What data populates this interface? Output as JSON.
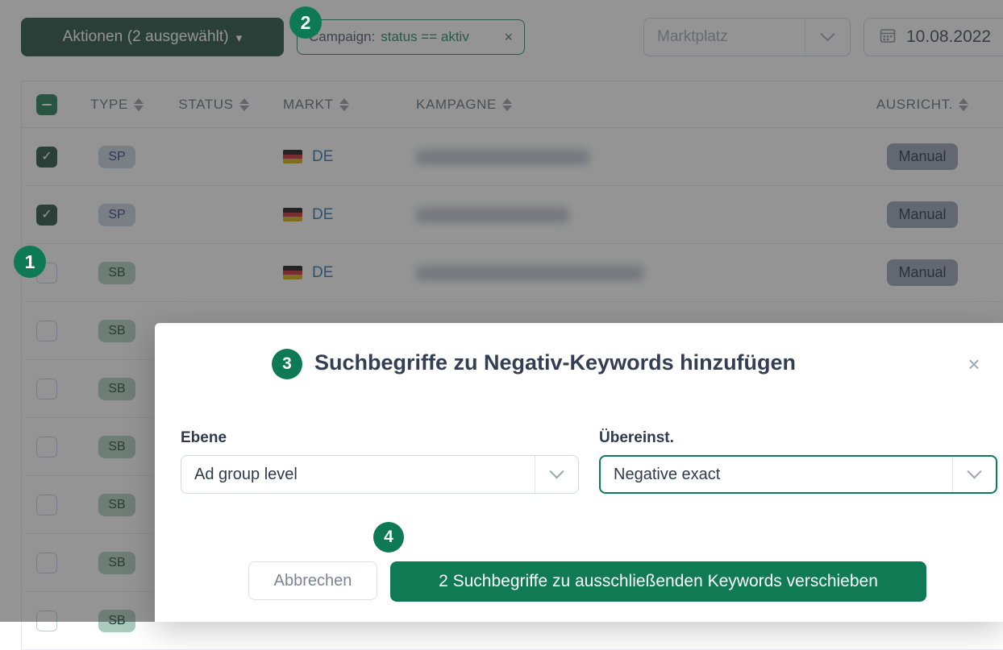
{
  "toolbar": {
    "actions_button": "Aktionen (2 ausgewählt)",
    "actions_caret": "chevron-down-icon",
    "filter_chip": {
      "field": "Campaign:",
      "expression": "status == aktiv",
      "remove": "×"
    },
    "marketplace": {
      "placeholder": "Marktplatz"
    },
    "date": {
      "value": "10.08.2022"
    }
  },
  "table": {
    "columns": [
      {
        "key": "check",
        "label": ""
      },
      {
        "key": "type",
        "label": "TYPE"
      },
      {
        "key": "status",
        "label": "STATUS"
      },
      {
        "key": "markt",
        "label": "MARKT"
      },
      {
        "key": "kamp",
        "label": "KAMPAGNE"
      },
      {
        "key": "ausr",
        "label": "AUSRICHT."
      }
    ],
    "header_select_all_state": "indeterminate",
    "rows": [
      {
        "checked": true,
        "type": "SP",
        "type_style": "sp",
        "status": "",
        "markt": "DE",
        "kampagne": "",
        "redacted_width": 215,
        "ausricht": "Manual"
      },
      {
        "checked": true,
        "type": "SP",
        "type_style": "sp",
        "status": "",
        "markt": "DE",
        "kampagne": "",
        "redacted_width": 190,
        "ausricht": "Manual"
      },
      {
        "checked": false,
        "type": "SB",
        "type_style": "sb",
        "status": "",
        "markt": "DE",
        "kampagne": "",
        "redacted_width": 283,
        "ausricht": "Manual"
      },
      {
        "checked": false,
        "type": "SB",
        "type_style": "sb",
        "status": "",
        "markt": "",
        "kampagne": "",
        "redacted_width": 0,
        "ausricht": ""
      },
      {
        "checked": false,
        "type": "SB",
        "type_style": "sb",
        "status": "",
        "markt": "",
        "kampagne": "",
        "redacted_width": 0,
        "ausricht": ""
      },
      {
        "checked": false,
        "type": "SB",
        "type_style": "sb",
        "status": "",
        "markt": "",
        "kampagne": "",
        "redacted_width": 0,
        "ausricht": ""
      },
      {
        "checked": false,
        "type": "SB",
        "type_style": "sb",
        "status": "",
        "markt": "",
        "kampagne": "",
        "redacted_width": 0,
        "ausricht": ""
      },
      {
        "checked": false,
        "type": "SB",
        "type_style": "sb",
        "status": "",
        "markt": "",
        "kampagne": "",
        "redacted_width": 0,
        "ausricht": ""
      },
      {
        "checked": false,
        "type": "SB",
        "type_style": "sb",
        "status": "",
        "markt": "",
        "kampagne": "",
        "redacted_width": 0,
        "ausricht": ""
      }
    ]
  },
  "modal": {
    "title": "Suchbegriffe zu Negativ-Keywords hinzufügen",
    "close": "×",
    "fields": {
      "level": {
        "label": "Ebene",
        "value": "Ad group level",
        "focused": false
      },
      "match": {
        "label": "Übereinst.",
        "value": "Negative exact",
        "focused": true
      }
    },
    "buttons": {
      "cancel": "Abbrechen",
      "submit": "2 Suchbegriffe zu ausschließenden Keywords verschieben"
    }
  },
  "steps": [
    {
      "id": 1,
      "label": "1"
    },
    {
      "id": 2,
      "label": "2"
    },
    {
      "id": 3,
      "label": "3"
    },
    {
      "id": 4,
      "label": "4"
    }
  ],
  "colors": {
    "brand_green": "#0f7a54",
    "dark_green": "#0c3f2d",
    "step_badge": "#0d7a55",
    "link_blue": "#1868a8",
    "text_dark": "#333e52"
  }
}
